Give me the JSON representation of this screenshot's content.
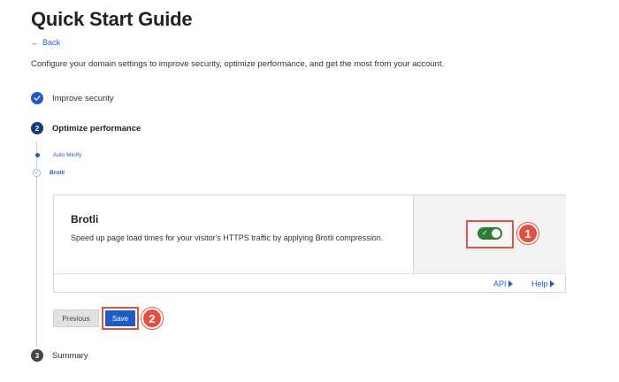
{
  "page": {
    "title": "Quick Start Guide",
    "back_label": "Back",
    "intro": "Configure your domain settings to improve security, optimize performance, and get the most from your account."
  },
  "steps": [
    {
      "number": "1",
      "label": "Improve security",
      "status": "done"
    },
    {
      "number": "2",
      "label": "Optimize performance",
      "status": "active"
    },
    {
      "number": "3",
      "label": "Summary",
      "status": "pending"
    }
  ],
  "substeps": [
    {
      "label": "Auto Minify",
      "status": "done"
    },
    {
      "label": "Brotli",
      "status": "current"
    }
  ],
  "card": {
    "title": "Brotli",
    "description": "Speed up page load times for your visitor's HTTPS traffic by applying Brotli compression.",
    "toggle_on": true,
    "links": [
      "API",
      "Help"
    ]
  },
  "buttons": {
    "previous": "Previous",
    "save": "Save"
  },
  "annotations": [
    "1",
    "2"
  ],
  "colors": {
    "accent": "#1f5ac8",
    "toggle_on": "#2f7d32",
    "annotation": "#e44f44"
  }
}
